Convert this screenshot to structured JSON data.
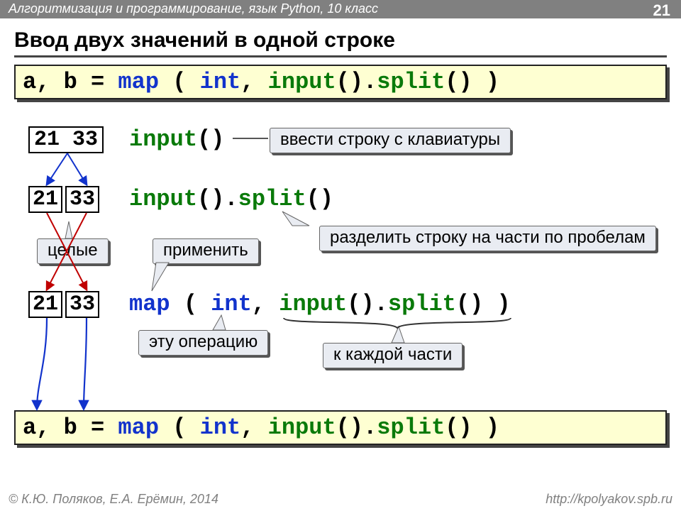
{
  "header": {
    "course": "Алгоритмизация и программирование, язык Python, 10 класс",
    "page": "21"
  },
  "title": "Ввод двух значений в одной строке",
  "code_top": {
    "lhs": "a, b = ",
    "map": "map",
    "int": "int",
    "input": "input",
    "split": "split"
  },
  "row1": {
    "value": "21 33",
    "code_input": "input",
    "hint": "ввести строку с клавиатуры"
  },
  "row2": {
    "v1": "21",
    "v2": "33",
    "code_input": "input",
    "code_split": "split",
    "hint_split": "разделить строку на части по пробелам",
    "hint_ints": "целые",
    "hint_apply": "применить"
  },
  "row3": {
    "v1": "21",
    "v2": "33",
    "map": "map",
    "int": "int",
    "input": "input",
    "split": "split",
    "hint_op": "эту операцию",
    "hint_each": "к каждой части"
  },
  "code_bottom": {
    "lhs": "a, b = ",
    "map": "map",
    "int": "int",
    "input": "input",
    "split": "split"
  },
  "footer": {
    "left": "© К.Ю. Поляков, Е.А. Ерёмин, 2014",
    "right": "http://kpolyakov.spb.ru"
  }
}
